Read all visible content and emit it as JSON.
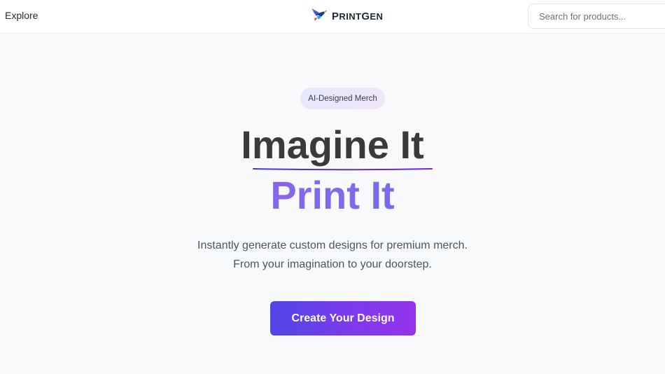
{
  "header": {
    "explore_label": "Explore",
    "logo_text_first": "P",
    "logo_text_rest": "RINT",
    "logo_text_g": "G",
    "logo_text_tail": "EN",
    "search_placeholder": "Search for products..."
  },
  "hero": {
    "badge": "AI-Designed Merch",
    "headline": "Imagine It",
    "subheadline": "Print It",
    "description_line1": "Instantly generate custom designs for premium merch.",
    "description_line2": "From your imagination to your doorstep.",
    "cta_label": "Create Your Design"
  },
  "colors": {
    "accent_start": "#4f46e5",
    "accent_end": "#9333ea",
    "gradient_text_start": "#a855f7",
    "gradient_text_end": "#6366f1"
  },
  "icons": {
    "logo": "bird-logo-icon"
  }
}
